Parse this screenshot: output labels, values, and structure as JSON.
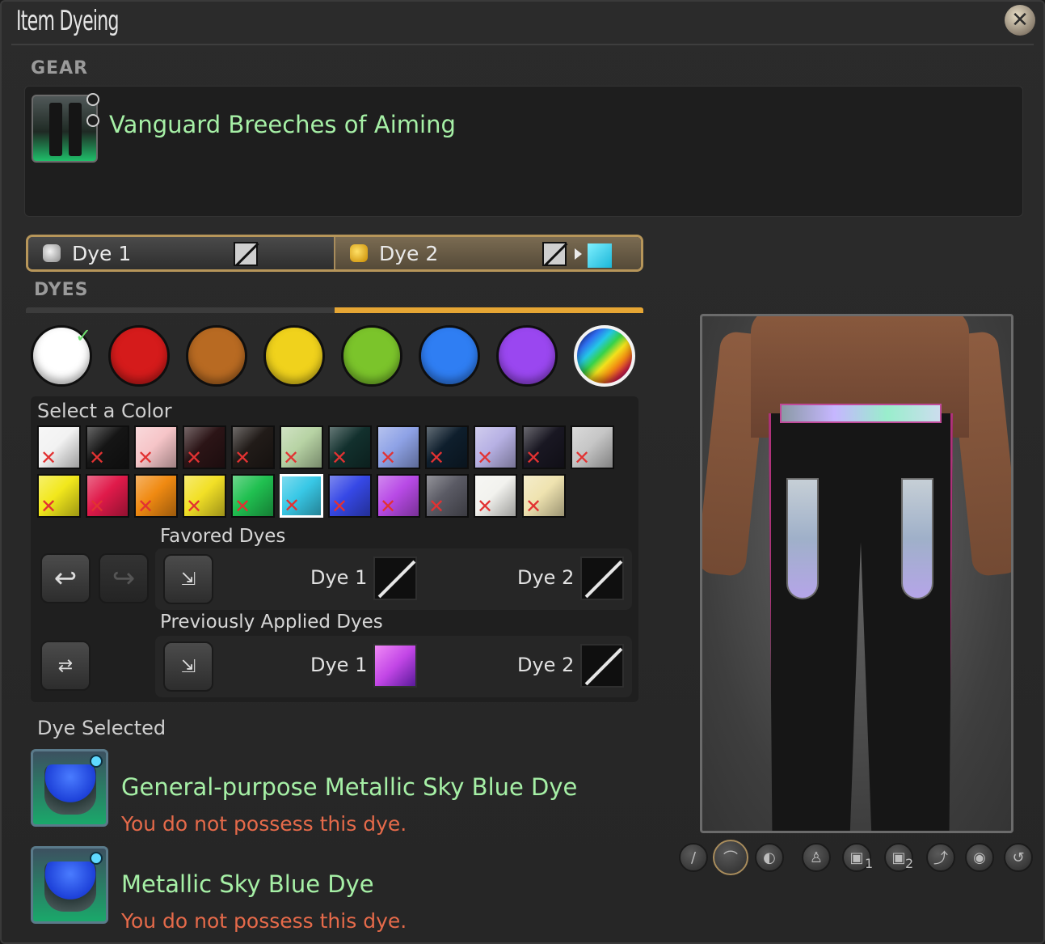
{
  "window": {
    "title": "Item Dyeing",
    "close_icon": "close-icon"
  },
  "gear": {
    "section_label": "GEAR",
    "item_name": "Vanguard Breeches of Aiming"
  },
  "dye_tabs": [
    {
      "label": "Dye 1",
      "icon": "dye-pot-icon",
      "value": "none"
    },
    {
      "label": "Dye 2",
      "icon": "dye-pot-icon",
      "value": "none",
      "preview_color": "#38c8e6"
    }
  ],
  "dyes": {
    "section_label": "DYES",
    "categories": [
      {
        "name": "white",
        "color": "#ffffff",
        "checked": true
      },
      {
        "name": "red",
        "color": "#d51b1b"
      },
      {
        "name": "brown",
        "color": "#b86a22"
      },
      {
        "name": "yellow",
        "color": "#f0d21c"
      },
      {
        "name": "green",
        "color": "#7bc42b"
      },
      {
        "name": "blue",
        "color": "#2f7ef3"
      },
      {
        "name": "purple",
        "color": "#9a47f0"
      },
      {
        "name": "special",
        "color": "rainbow",
        "selected": true
      }
    ],
    "palette_title": "Select a Color",
    "palette_rows": [
      [
        "#f2f2f2",
        "#151515",
        "#f6c5c8",
        "#2b1416",
        "#211b18",
        "#b7d3a4",
        "#12302d",
        "#8ea2e6",
        "#0e1e2c",
        "#b7b1e4",
        "#191722",
        "#c6c6c6"
      ],
      [
        "#f2e81c",
        "#e01a4a",
        "#f08a12",
        "#f2e026",
        "#20c050",
        "#38c8e6",
        "#3648e6",
        "#b84ae6",
        "#5a5a64",
        "#f2f2ee",
        "#efe3b0"
      ]
    ],
    "palette_selected": {
      "row": 1,
      "col": 5
    }
  },
  "favored": {
    "title": "Favored Dyes",
    "dye1_label": "Dye 1",
    "dye2_label": "Dye 2"
  },
  "previous": {
    "title": "Previously Applied Dyes",
    "dye1_label": "Dye 1",
    "dye2_label": "Dye 2",
    "dye1_color": "#c246e6"
  },
  "selected": {
    "label": "Dye Selected",
    "items": [
      {
        "name": "General-purpose Metallic Sky Blue Dye",
        "status": "You do not possess this dye."
      },
      {
        "name": "Metallic Sky Blue Dye",
        "status": "You do not possess this dye."
      }
    ]
  },
  "toolbar": {
    "icons": [
      "weapon-icon",
      "headgear-icon",
      "visor-icon",
      "character-icon",
      "dye1-icon",
      "dye2-icon",
      "pose-icon",
      "view-icon",
      "reset-icon"
    ],
    "dye1_sub": "1",
    "dye2_sub": "2"
  }
}
